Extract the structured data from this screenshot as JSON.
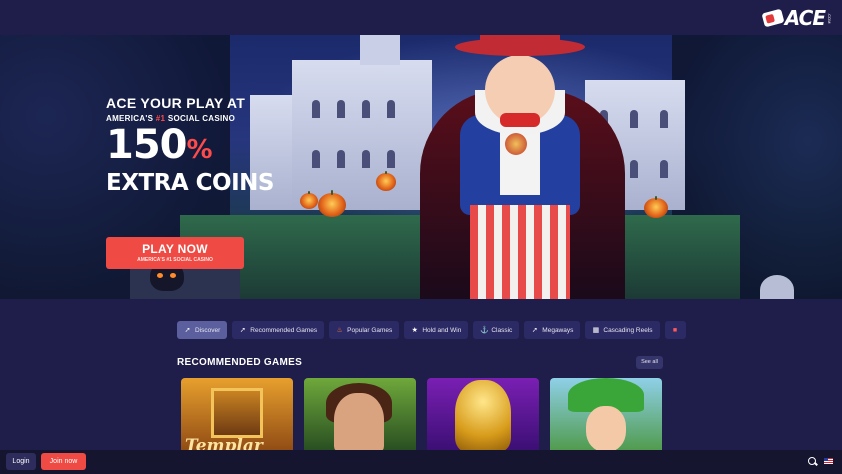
{
  "brand": {
    "logo_text": "ACE",
    "logo_sub": ".COM"
  },
  "hero": {
    "line1": "ACE YOUR PLAY AT",
    "line2_pre": "AMERICA'S ",
    "line2_highlight": "#1",
    "line2_post": " SOCIAL CASINO",
    "amount": "150",
    "percent": "%",
    "line4": "EXTRA COINS",
    "cta_label": "PLAY NOW",
    "cta_sub": "AMERICA'S #1 SOCIAL CASINO"
  },
  "tabs": [
    {
      "label": "Discover",
      "icon": "rocket-icon",
      "active": true
    },
    {
      "label": "Recommended Games",
      "icon": "rocket-icon"
    },
    {
      "label": "Popular Games",
      "icon": "fire-icon"
    },
    {
      "label": "Hold and Win",
      "icon": "star-icon"
    },
    {
      "label": "Classic",
      "icon": "anchor-icon"
    },
    {
      "label": "Megaways",
      "icon": "rocket-icon"
    },
    {
      "label": "Cascading Reels",
      "icon": "grid-icon"
    }
  ],
  "section": {
    "title": "RECOMMENDED GAMES",
    "see_all": "See all"
  },
  "games": [
    {
      "title": "Templar"
    },
    {
      "title": ""
    },
    {
      "title": ""
    },
    {
      "title": ""
    }
  ],
  "footer": {
    "login": "Login",
    "join": "Join now"
  },
  "colors": {
    "background": "#1f1d4a",
    "accent": "#ef4a43",
    "tab": "#2c2a64",
    "tab_active": "#5b5f9e"
  }
}
